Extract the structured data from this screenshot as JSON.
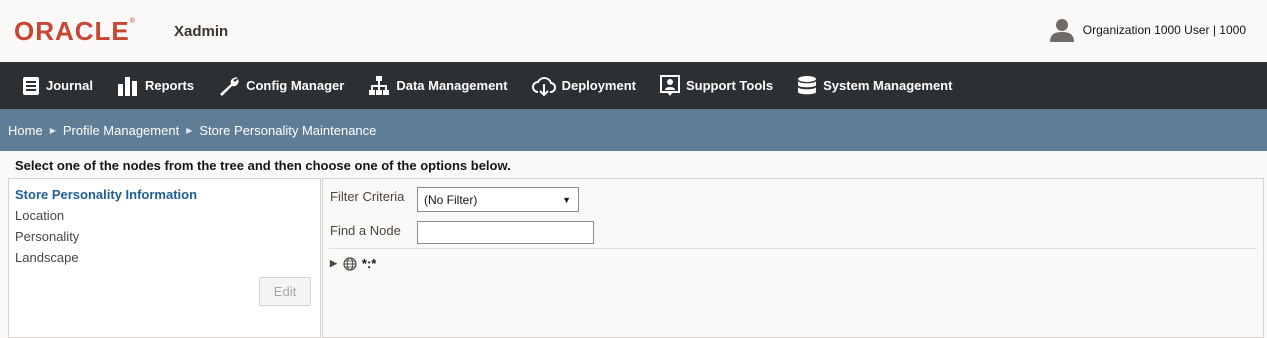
{
  "header": {
    "logo": "ORACLE",
    "logo_mark": "®",
    "app_name": "Xadmin",
    "user_label": "Organization 1000 User | 1000",
    "user_icon": "user-icon"
  },
  "nav": {
    "items": [
      {
        "label": "Journal",
        "icon": "journal-icon"
      },
      {
        "label": "Reports",
        "icon": "bar-chart-icon"
      },
      {
        "label": "Config Manager",
        "icon": "wrench-icon"
      },
      {
        "label": "Data Management",
        "icon": "hierarchy-icon"
      },
      {
        "label": "Deployment",
        "icon": "cloud-download-icon"
      },
      {
        "label": "Support Tools",
        "icon": "support-icon"
      },
      {
        "label": "System Management",
        "icon": "database-icon"
      }
    ]
  },
  "breadcrumb": {
    "items": [
      "Home",
      "Profile Management",
      "Store Personality Maintenance"
    ]
  },
  "instructions": "Select one of the nodes from the tree and then choose one of the options below.",
  "left_panel": {
    "items": [
      {
        "label": "Store Personality Information",
        "active": true
      },
      {
        "label": "Location"
      },
      {
        "label": "Personality"
      },
      {
        "label": "Landscape"
      }
    ],
    "edit_label": "Edit"
  },
  "right_panel": {
    "filter_label": "Filter Criteria",
    "filter_value": "(No Filter)",
    "find_label": "Find a Node",
    "find_value": "",
    "tree_root": "*:*"
  },
  "colors": {
    "brand_red": "#c74634",
    "nav_bg": "#2d3033",
    "breadcrumb_bg": "#5f7d95",
    "active_link": "#1f5d94"
  }
}
